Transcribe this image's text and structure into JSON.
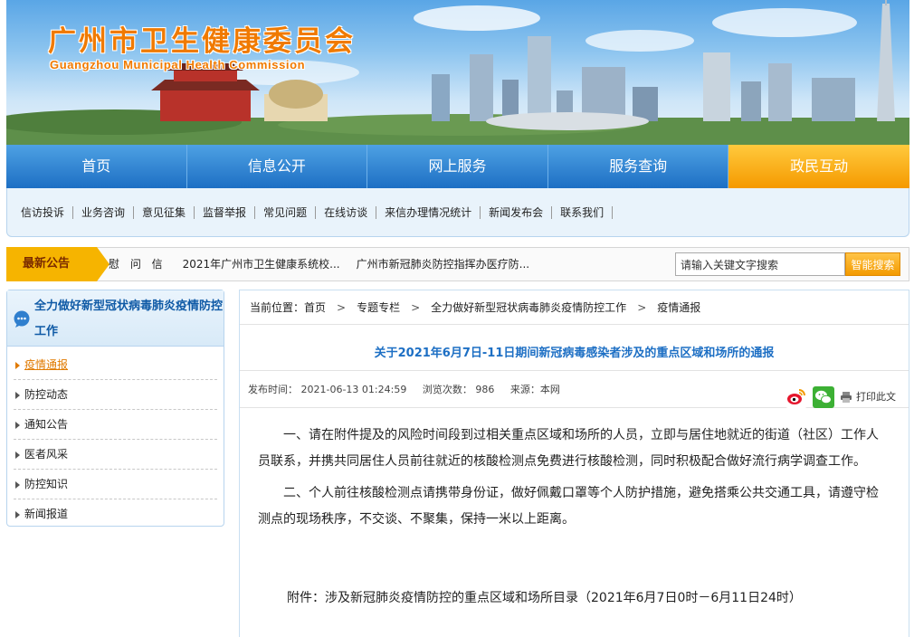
{
  "header": {
    "title": "广州市卫生健康委员会",
    "subtitle": "Guangzhou Municipal Health Commission"
  },
  "main_nav": [
    {
      "label": "首页"
    },
    {
      "label": "信息公开"
    },
    {
      "label": "网上服务"
    },
    {
      "label": "服务查询"
    },
    {
      "label": "政民互动"
    }
  ],
  "sub_nav": [
    {
      "label": "信访投诉"
    },
    {
      "label": "业务咨询"
    },
    {
      "label": "意见征集"
    },
    {
      "label": "监督举报"
    },
    {
      "label": "常见问题"
    },
    {
      "label": "在线访谈"
    },
    {
      "label": "来信办理情况统计"
    },
    {
      "label": "新闻发布会"
    },
    {
      "label": "联系我们"
    }
  ],
  "notice": {
    "label": "最新公告",
    "items": [
      "慰 问 信",
      "2021年广州市卫生健康系统校...",
      "广州市新冠肺炎防控指挥办医疗防..."
    ]
  },
  "search": {
    "value": "请输入关键文字搜索",
    "button": "智能搜索"
  },
  "sidebar": {
    "title": "全力做好新型冠状病毒肺炎疫情防控工作",
    "links": [
      {
        "label": "疫情通报"
      },
      {
        "label": "防控动态"
      },
      {
        "label": "通知公告"
      },
      {
        "label": "医者风采"
      },
      {
        "label": "防控知识"
      },
      {
        "label": "新闻报道"
      }
    ]
  },
  "breadcrumb": {
    "prefix": "当前位置：",
    "items": [
      "首页",
      "专题专栏",
      "全力做好新型冠状病毒肺炎疫情防控工作",
      "疫情通报"
    ],
    "separator": ">"
  },
  "article": {
    "title": "关于2021年6月7日-11日期间新冠病毒感染者涉及的重点区域和场所的通报",
    "publish_time": "发布时间： 2021-06-13 01:24:59",
    "views": "浏览次数：  986",
    "source": "来源：本网",
    "print": "打印此文",
    "paragraphs": [
      "一、请在附件提及的风险时间段到过相关重点区域和场所的人员，立即与居住地就近的街道（社区）工作人员联系，并携共同居住人员前往就近的核酸检测点免费进行核酸检测，同时积极配合做好流行病学调查工作。",
      "二、个人前往核酸检测点请携带身份证，做好佩戴口罩等个人防护措施，避免搭乘公共交通工具，请遵守检测点的现场秩序，不交谈、不聚集，保持一米以上距离。"
    ],
    "attachment": "附件：涉及新冠肺炎疫情防控的重点区域和场所目录（2021年6月7日0时－6月11日24时）"
  },
  "colors": {
    "nav_blue": "#1d6fc4",
    "accent_orange": "#f59a00",
    "title_orange": "#f07a00"
  }
}
